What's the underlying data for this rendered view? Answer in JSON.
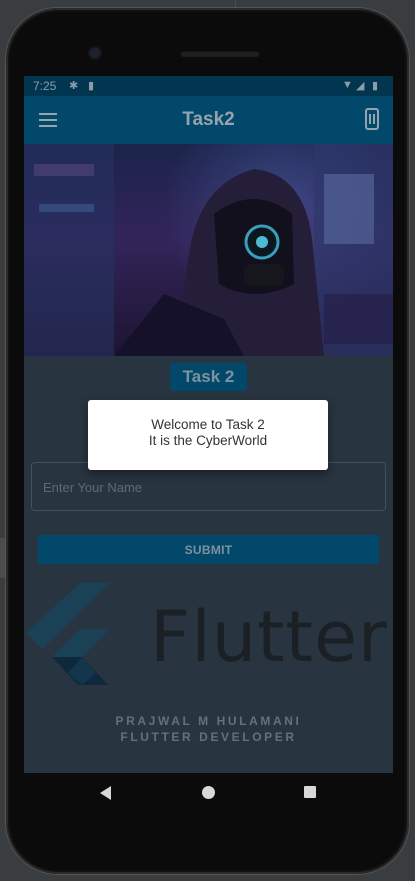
{
  "status_bar": {
    "time": "7:25",
    "icons": [
      "settings-icon",
      "sim-card-icon",
      "wifi-icon",
      "signal-icon",
      "battery-icon"
    ]
  },
  "app_bar": {
    "title": "Task2",
    "left_icon": "menu-icon",
    "right_icon": "screen-rotation-icon"
  },
  "main": {
    "hero_image": "hooded-figure-cyberpunk-image",
    "badge": "Task 2",
    "name_input": {
      "placeholder": "Enter Your Name",
      "value": ""
    },
    "submit_label": "SUBMIT",
    "logo_word": "Flutter",
    "credit_line1": "PRAJWAL M HULAMANI",
    "credit_line2": "FLUTTER DEVELOPER"
  },
  "dialog": {
    "line1": "Welcome to Task 2",
    "line2": "It is the CyberWorld"
  },
  "nav_bar": {
    "icons": [
      "back-icon",
      "home-icon",
      "recents-icon"
    ]
  },
  "colors": {
    "app_bar": "#03527a",
    "status_bar": "#033d5c",
    "screen_bg": "#2e3c48",
    "dialog_bg": "#ffffff"
  }
}
